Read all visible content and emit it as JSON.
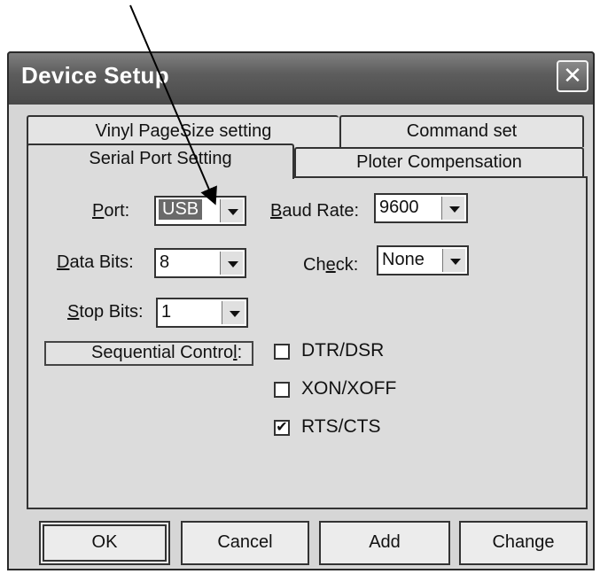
{
  "window": {
    "title": "Device Setup",
    "close_symbol": "✕"
  },
  "tabs": [
    {
      "label": "Vinyl PageSize setting",
      "selected": false
    },
    {
      "label": "Command set",
      "selected": false
    },
    {
      "label": "Serial Port Setting",
      "selected": true
    },
    {
      "label": "Ploter Compensation",
      "selected": false
    }
  ],
  "fields": {
    "port": {
      "label_mnemonic": "P",
      "label_rest": "ort:",
      "value": "USB"
    },
    "baud_rate": {
      "label_mnemonic": "B",
      "label_rest": "aud Rate:",
      "value": "9600"
    },
    "data_bits": {
      "label_mnemonic": "D",
      "label_rest": "ata Bits:",
      "value": "8"
    },
    "check": {
      "label_pre": "Ch",
      "label_mnemonic": "e",
      "label_rest": "ck:",
      "value": "None"
    },
    "stop_bits": {
      "label_mnemonic": "S",
      "label_rest": "top Bits:",
      "value": "1"
    }
  },
  "sequential_control": {
    "label_pre": "Sequential Contro",
    "label_mnemonic": "l",
    "label_rest": ":"
  },
  "checkboxes": [
    {
      "label": "DTR/DSR",
      "checked": false
    },
    {
      "label": "XON/XOFF",
      "checked": false
    },
    {
      "label": "RTS/CTS",
      "checked": true
    }
  ],
  "check_mark": "✔",
  "buttons": {
    "ok": "OK",
    "cancel": "Cancel",
    "add": "Add",
    "change": "Change"
  }
}
